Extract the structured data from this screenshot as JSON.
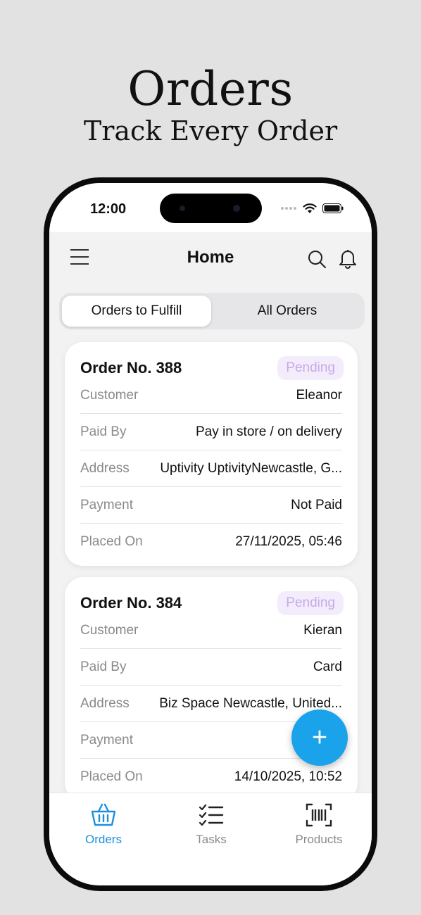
{
  "promo": {
    "title": "Orders",
    "subtitle": "Track Every Order"
  },
  "status_bar": {
    "time": "12:00"
  },
  "app_bar": {
    "title": "Home"
  },
  "segments": {
    "fulfill": "Orders to Fulfill",
    "all": "All Orders",
    "selected": "Orders to Fulfill"
  },
  "orders": [
    {
      "title": "Order No. 388",
      "status": "Pending",
      "rows": [
        {
          "label": "Customer",
          "value": "Eleanor"
        },
        {
          "label": "Paid By",
          "value": "Pay in store / on delivery"
        },
        {
          "label": "Address",
          "value": "Uptivity UptivityNewcastle, G..."
        },
        {
          "label": "Payment",
          "value": "Not Paid"
        },
        {
          "label": "Placed On",
          "value": "27/11/2025, 05:46"
        }
      ]
    },
    {
      "title": "Order No. 384",
      "status": "Pending",
      "rows": [
        {
          "label": "Customer",
          "value": "Kieran"
        },
        {
          "label": "Paid By",
          "value": "Card"
        },
        {
          "label": "Address",
          "value": "Biz Space Newcastle, United..."
        },
        {
          "label": "Payment",
          "value": ""
        },
        {
          "label": "Placed On",
          "value": "14/10/2025, 10:52"
        }
      ]
    }
  ],
  "fab": {
    "icon": "plus-icon",
    "label": "+"
  },
  "tabs": [
    {
      "label": "Orders",
      "icon": "basket-icon",
      "active": true
    },
    {
      "label": "Tasks",
      "icon": "checklist-icon",
      "active": false
    },
    {
      "label": "Products",
      "icon": "barcode-icon",
      "active": false
    }
  ],
  "colors": {
    "accent": "#1aa3ea",
    "tab_active": "#1a8fe0",
    "tab_inactive": "#8a8a8a",
    "badge_bg": "#f3ecfb",
    "badge_text": "#c7a9ea",
    "page_bg": "#e2e2e2"
  }
}
